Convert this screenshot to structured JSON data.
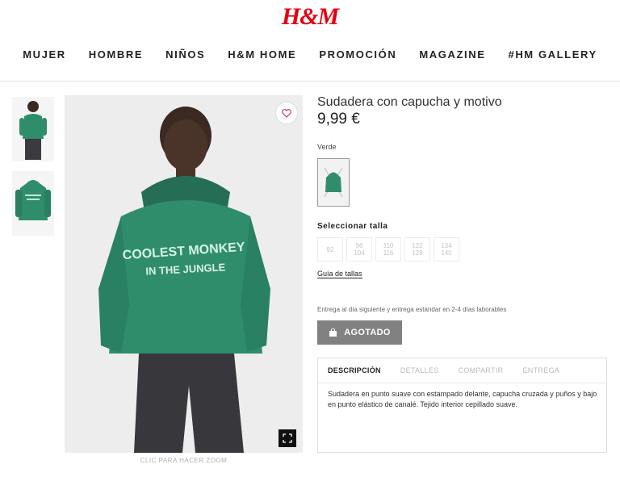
{
  "header": {
    "logo": "H&M",
    "nav": [
      "MUJER",
      "HOMBRE",
      "NIÑOS",
      "H&M HOME",
      "PROMOCIÓN",
      "MAGAZINE",
      "#HM GALLERY"
    ]
  },
  "gallery": {
    "zoom_hint": "CLIC PARA HACER ZOOM",
    "hoodie_print": [
      "COOLEST MONKEY",
      "IN THE JUNGLE"
    ]
  },
  "product": {
    "title": "Sudadera con capucha y motivo",
    "price": "9,99 €",
    "color_name": "Verde",
    "size_label": "Seleccionar talla",
    "sizes": [
      "92",
      "98\n104",
      "110\n116",
      "122\n128",
      "134\n140"
    ],
    "size_guide": "Guía de tallas",
    "delivery": "Entrega al día siguiente y entrega estándar en 2-4 días laborables",
    "button_label": "AGOTADO"
  },
  "tabs": [
    "DESCRIPCIÓN",
    "DETALLES",
    "COMPARTIR",
    "ENTREGA"
  ],
  "description": "Sudadera en punto suave con estampado delante, capucha cruzada y puños y bajo en punto elástico de canalé. Tejido interior cepillado suave.",
  "colors": {
    "brand_red": "#e50010",
    "hoodie_green": "#2f8d6b",
    "button_gray": "#818181"
  }
}
